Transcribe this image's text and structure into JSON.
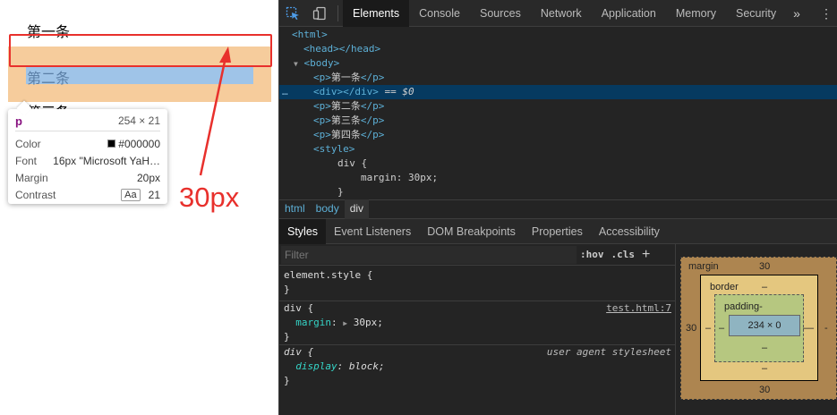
{
  "page": {
    "p1": "第一条",
    "p2": "第二条",
    "p3": "第三条",
    "annotation": "30px"
  },
  "tooltip": {
    "tag": "p",
    "size": "254 × 21",
    "rows": [
      {
        "label": "Color",
        "value": "#000000"
      },
      {
        "label": "Font",
        "value": "16px \"Microsoft YaH…"
      },
      {
        "label": "Margin",
        "value": "20px"
      },
      {
        "label": "Contrast",
        "badge": "Aa",
        "value": "21"
      }
    ]
  },
  "devtools": {
    "tabs": [
      "Elements",
      "Console",
      "Sources",
      "Network",
      "Application",
      "Memory",
      "Security"
    ],
    "active_tab": "Elements",
    "more": "»",
    "kebab": "⋮",
    "dom_tree": [
      {
        "open": "<html>"
      },
      {
        "open": "<head></head>"
      },
      {
        "triangle": "▼",
        "open": "<body>"
      },
      {
        "open": "<p>",
        "text": "第一条",
        "close": "</p>"
      },
      {
        "dots": "…",
        "open": "<div></div>",
        "eq": " == ",
        "dollar": "$0"
      },
      {
        "open": "<p>",
        "text": "第二条",
        "close": "</p>"
      },
      {
        "open": "<p>",
        "text": "第三条",
        "close": "</p>"
      },
      {
        "open": "<p>",
        "text": "第四条",
        "close": "</p>"
      },
      {
        "open": "<style>"
      },
      {
        "text": "div {"
      },
      {
        "text": "margin: 30px;"
      },
      {
        "text": "}"
      }
    ],
    "breadcrumbs": [
      "html",
      "body",
      "div"
    ],
    "styles_tabs": [
      "Styles",
      "Event Listeners",
      "DOM Breakpoints",
      "Properties",
      "Accessibility"
    ],
    "active_styles_tab": "Styles",
    "filter_placeholder": "Filter",
    "hov": ":hov",
    "cls": ".cls",
    "plus": "+",
    "rules": [
      {
        "selector": "element.style {",
        "close": "}"
      },
      {
        "selector": "div {",
        "source": "test.html:7",
        "prop": "margin",
        "arrow": "▶",
        "value": "30px;",
        "close": "}"
      },
      {
        "selector": "div {",
        "source": "user agent stylesheet",
        "prop": "display",
        "value": "block;",
        "close": "}"
      }
    ],
    "box_model": {
      "margin_label": "margin",
      "margin_top": "30",
      "margin_bottom": "30",
      "margin_left": "30",
      "margin_right": "-",
      "border_label": "border",
      "border_top": "–",
      "border_bottom": "–",
      "border_left": "–",
      "border_right": "–",
      "padding_label": "padding-",
      "padding_bottom": "–",
      "padding_left": "–",
      "padding_right": "–",
      "content": "234 × 0"
    }
  },
  "colors": {
    "annotation_red": "#e8302c",
    "margin_highlight": "#f6cc9c",
    "content_highlight": "#9fc4e8",
    "devtools_bg": "#242424",
    "selected_row": "#063a60"
  }
}
